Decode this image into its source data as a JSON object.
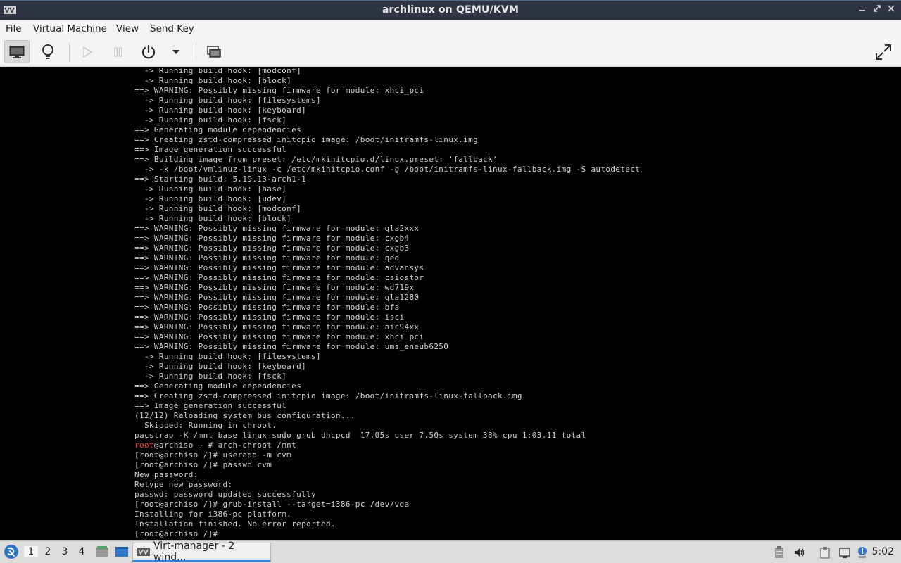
{
  "window": {
    "title": "archlinux on QEMU/KVM",
    "controls": [
      "minimize",
      "restore",
      "close"
    ]
  },
  "menu": {
    "items": [
      {
        "label": "File"
      },
      {
        "label": "Virtual Machine"
      },
      {
        "label": "View"
      },
      {
        "label": "Send Key"
      }
    ]
  },
  "toolbar": {
    "buttons": [
      "console-view",
      "details-view",
      "run",
      "pause",
      "shutdown",
      "shutdown-menu",
      "snapshots",
      "fullscreen"
    ],
    "active": "console-view"
  },
  "console": {
    "lines": [
      "  -> Running build hook: [modconf]",
      "  -> Running build hook: [block]",
      "==> WARNING: Possibly missing firmware for module: xhci_pci",
      "  -> Running build hook: [filesystems]",
      "  -> Running build hook: [keyboard]",
      "  -> Running build hook: [fsck]",
      "==> Generating module dependencies",
      "==> Creating zstd-compressed initcpio image: /boot/initramfs-linux.img",
      "==> Image generation successful",
      "==> Building image from preset: /etc/mkinitcpio.d/linux.preset: 'fallback'",
      "  -> -k /boot/vmlinuz-linux -c /etc/mkinitcpio.conf -g /boot/initramfs-linux-fallback.img -S autodetect",
      "==> Starting build: 5.19.13-arch1-1",
      "  -> Running build hook: [base]",
      "  -> Running build hook: [udev]",
      "  -> Running build hook: [modconf]",
      "  -> Running build hook: [block]",
      "==> WARNING: Possibly missing firmware for module: qla2xxx",
      "==> WARNING: Possibly missing firmware for module: cxgb4",
      "==> WARNING: Possibly missing firmware for module: cxgb3",
      "==> WARNING: Possibly missing firmware for module: qed",
      "==> WARNING: Possibly missing firmware for module: advansys",
      "==> WARNING: Possibly missing firmware for module: csiostor",
      "==> WARNING: Possibly missing firmware for module: wd719x",
      "==> WARNING: Possibly missing firmware for module: qla1280",
      "==> WARNING: Possibly missing firmware for module: bfa",
      "==> WARNING: Possibly missing firmware for module: isci",
      "==> WARNING: Possibly missing firmware for module: aic94xx",
      "==> WARNING: Possibly missing firmware for module: xhci_pci",
      "==> WARNING: Possibly missing firmware for module: ums_eneub6250",
      "  -> Running build hook: [filesystems]",
      "  -> Running build hook: [keyboard]",
      "  -> Running build hook: [fsck]",
      "==> Generating module dependencies",
      "==> Creating zstd-compressed initcpio image: /boot/initramfs-linux-fallback.img",
      "==> Image generation successful",
      "(12/12) Reloading system bus configuration...",
      "  Skipped: Running in chroot.",
      "pacstrap -K /mnt base linux sudo grub dhcpcd  17.05s user 7.50s system 38% cpu 1:03.11 total",
      "root@archiso ~ # arch-chroot /mnt",
      "[root@archiso /]# useradd -m cvm",
      "[root@archiso /]# passwd cvm",
      "New password:",
      "Retype new password:",
      "passwd: password updated successfully",
      "[root@archiso /]# grub-install --target=i386-pc /dev/vda",
      "Installing for i386-pc platform.",
      "Installation finished. No error reported.",
      "[root@archiso /]#"
    ],
    "prompt_user": "root",
    "prompt_line_index": 38,
    "colors": {
      "text": "#d0d0d0",
      "prompt_user": "#ff3b3b",
      "background": "#000000"
    }
  },
  "taskbar": {
    "workspaces": [
      "1",
      "2",
      "3",
      "4"
    ],
    "active_workspace": "1",
    "task_label": "Virt-manager - 2 wind...",
    "clock": "5:02"
  }
}
